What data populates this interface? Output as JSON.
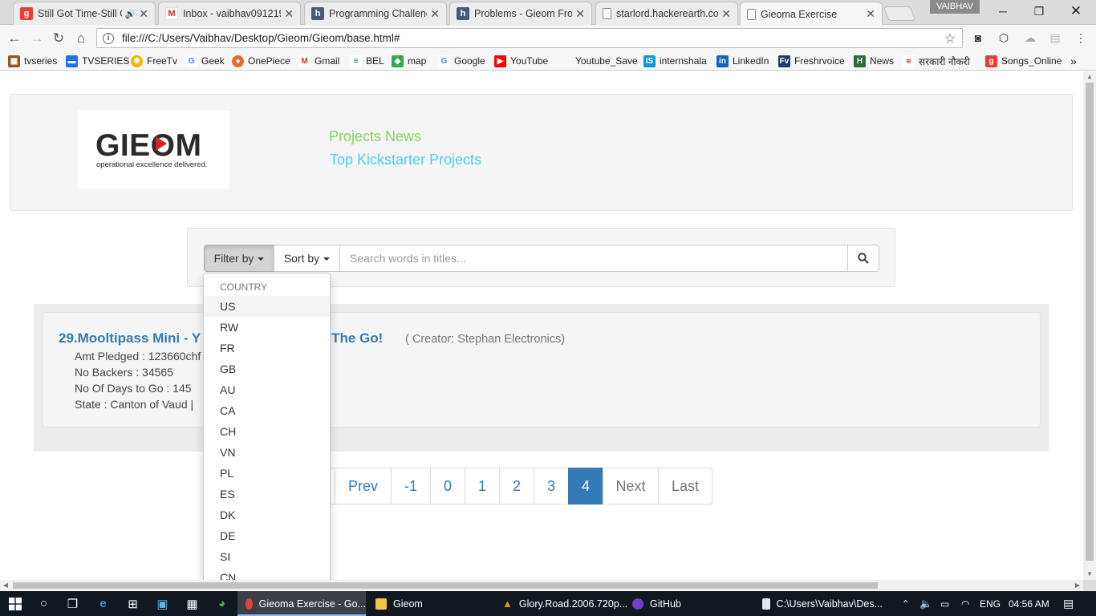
{
  "browser": {
    "tabs": [
      {
        "title": "Still Got Time-Still G",
        "icon": "g",
        "color": "#e8402f",
        "audio": true
      },
      {
        "title": "Inbox - vaibhav091219",
        "icon": "M",
        "color": "#d93025"
      },
      {
        "title": "Programming Challeng",
        "icon": "h",
        "color": "#4b5a74"
      },
      {
        "title": "Problems - Gieom Fron",
        "icon": "h",
        "color": "#4b5a74"
      },
      {
        "title": "starlord.hackerearth.co",
        "icon": "doc",
        "color": "#888888"
      },
      {
        "title": "Gieoma Exercise",
        "icon": "doc",
        "color": "#888888",
        "active": true
      }
    ],
    "user": "VAIBHAV",
    "url": "file:///C:/Users/Vaibhav/Desktop/Gieom/Gieom/base.html#",
    "bookmarks": [
      {
        "label": "tvseries",
        "icon": "film",
        "color": "#8b5a2b"
      },
      {
        "label": "TVSERIES",
        "icon": "tv",
        "color": "#1a73e8"
      },
      {
        "label": "FreeTv",
        "icon": "sun",
        "color": "#f5b400"
      },
      {
        "label": "Geek",
        "icon": "G",
        "color": "#4285f4"
      },
      {
        "label": "OnePiece",
        "icon": "op",
        "color": "#e96b2a"
      },
      {
        "label": "Gmail",
        "icon": "M",
        "color": "#d93025"
      },
      {
        "label": "BEL",
        "icon": "bel",
        "color": "#1b4fa0"
      },
      {
        "label": "map",
        "icon": "map",
        "color": "#34a853"
      },
      {
        "label": "Google",
        "icon": "G",
        "color": "#4285f4"
      },
      {
        "label": "YouTube",
        "icon": "yt",
        "color": "#ff0000"
      },
      {
        "label": "Youtube_Save",
        "icon": "",
        "color": "#ffffff"
      },
      {
        "label": "internshala",
        "icon": "is",
        "color": "#1296db"
      },
      {
        "label": "LinkedIn",
        "icon": "in",
        "color": "#0a66c2"
      },
      {
        "label": "Freshrvoice",
        "icon": "Fv",
        "color": "#1e3a6e"
      },
      {
        "label": "News",
        "icon": "H",
        "color": "#2e6b3a"
      },
      {
        "label": "सरकारी नौकरी",
        "icon": "sn",
        "color": "#c0392b"
      },
      {
        "label": "Songs_Online",
        "icon": "g",
        "color": "#e8402f"
      }
    ]
  },
  "page": {
    "logo": {
      "word": "GIEOM",
      "tagline": "operational excellence delivered."
    },
    "nav": [
      "Projects News",
      "Top Kickstarter Projects"
    ],
    "search": {
      "filter_label": "Filter by",
      "sort_label": "Sort by",
      "placeholder": "Search words in titles..."
    },
    "dropdown": {
      "header": "COUNTRY",
      "items": [
        "US",
        "RW",
        "FR",
        "GB",
        "AU",
        "CA",
        "CH",
        "VN",
        "PL",
        "ES",
        "DK",
        "DE",
        "SI",
        "CN"
      ]
    },
    "result": {
      "title_left": "29.Mooltipass Mini - Y",
      "title_right": "n The Go!",
      "creator": "( Creator: Stephan Electronics)",
      "lines": [
        "Amt Pledged :  123660chf",
        "No Backers :  34565",
        "No Of Days to Go :  145",
        "State :  Canton of Vaud   |"
      ]
    },
    "pagination": [
      "Prev",
      "-1",
      "0",
      "1",
      "2",
      "3",
      "4",
      "Next",
      "Last"
    ],
    "active_page": "4"
  },
  "taskbar": {
    "apps": [
      {
        "label": "Gieoma Exercise - Go...",
        "active": true
      },
      {
        "label": "Gieom"
      },
      {
        "label": "Glory.Road.2006.720p..."
      },
      {
        "label": "GitHub"
      },
      {
        "label": "C:\\Users\\Vaibhav\\Des..."
      }
    ],
    "lang": "ENG",
    "time": "04:56 AM"
  }
}
